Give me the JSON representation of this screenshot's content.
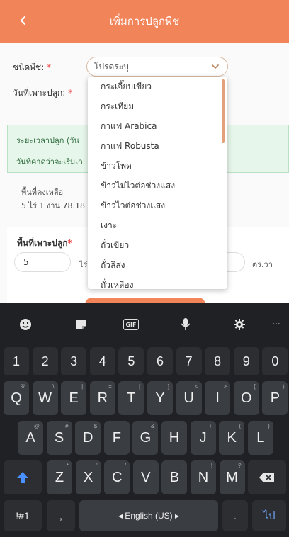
{
  "header": {
    "title": "เพิ่มการปลูกพืช"
  },
  "form": {
    "crop_label": "ชนิดพืช",
    "crop_placeholder": "โปรดระบุ",
    "planting_date_label": "วันที่เพาะปลูก",
    "required_mark": "*"
  },
  "info": {
    "duration": "ระยะเวลาปลูก (วัน",
    "expected_start": "วันที่คาดว่าจะเริ่มเก"
  },
  "remaining": {
    "label": "พื้นที่คงเหลือ",
    "value": "5 ไร่ 1 งาน 78.18"
  },
  "area": {
    "label": "พื้นที่เพาะปลูก",
    "required_mark": "*",
    "rai_value": "5",
    "rai_unit": "ไร่",
    "wa_unit": "ตร.วา"
  },
  "dropdown": {
    "options": [
      "กระเจี๊ยบเขียว",
      "กระเทียม",
      "กาแฟ Arabica",
      "กาแฟ Robusta",
      "ข้าวโพด",
      "ข้าวไม่ไวต่อช่วงแสง",
      "ข้าวไวต่อช่วงแสง",
      "เงาะ",
      "ถั่วเขียว",
      "ถั่วลิสง",
      "ถั่วเหลือง"
    ]
  },
  "keyboard": {
    "toolbar_gif": "GIF",
    "toolbar_more": "...",
    "numbers": [
      "1",
      "2",
      "3",
      "4",
      "5",
      "6",
      "7",
      "8",
      "9",
      "0"
    ],
    "row1": [
      "Q",
      "W",
      "E",
      "R",
      "T",
      "Y",
      "U",
      "I",
      "O",
      "P"
    ],
    "row1_sub": [
      "%",
      "\\",
      "|",
      "=",
      "[",
      "]",
      "<",
      ">",
      "{",
      "}"
    ],
    "row2": [
      "A",
      "S",
      "D",
      "F",
      "G",
      "H",
      "J",
      "K",
      "L"
    ],
    "row2_sub": [
      "@",
      "#",
      "$",
      "_",
      "&",
      "-",
      "+",
      "(",
      ")"
    ],
    "row3": [
      "Z",
      "X",
      "C",
      "V",
      "B",
      "N",
      "M"
    ],
    "row3_sub": [
      "*",
      "\"",
      "'",
      ":",
      ";",
      "!",
      "?"
    ],
    "symbols_key": "!#1",
    "comma_key": ",",
    "space_label": "◂ English (US) ▸",
    "period_key": ".",
    "go_key": "ไป"
  },
  "colors": {
    "accent": "#f2845a",
    "keyboard_bg": "#1f2124",
    "key_bg": "#3a3d42"
  }
}
